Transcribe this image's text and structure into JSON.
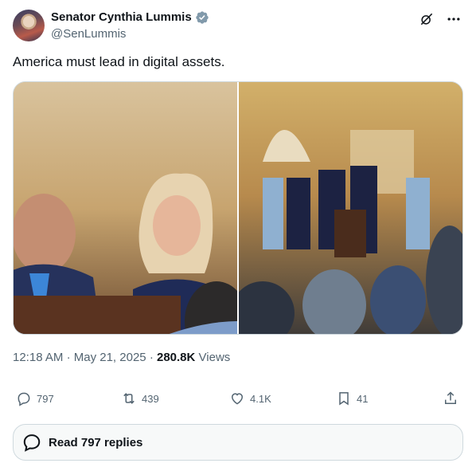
{
  "author": {
    "display_name": "Senator Cynthia Lummis",
    "handle": "@SenLummis",
    "verified": true,
    "verified_color": "#829aab"
  },
  "tweet": {
    "text": "America must lead in digital assets."
  },
  "meta": {
    "time": "12:18 AM",
    "separator": "·",
    "date": "May 21, 2025",
    "views_count": "280.8K",
    "views_label": "Views"
  },
  "actions": {
    "replies": "797",
    "retweets": "439",
    "likes": "4.1K",
    "bookmarks": "41"
  },
  "read_replies": {
    "label": "Read 797 replies"
  },
  "icons": [
    "grok-icon",
    "more-icon",
    "verified-badge-icon",
    "reply-icon",
    "retweet-icon",
    "like-icon",
    "bookmark-icon",
    "share-icon",
    "chat-bubble-icon"
  ],
  "colors": {
    "text_primary": "#0f1419",
    "text_secondary": "#536471",
    "border": "#cfd9de"
  }
}
